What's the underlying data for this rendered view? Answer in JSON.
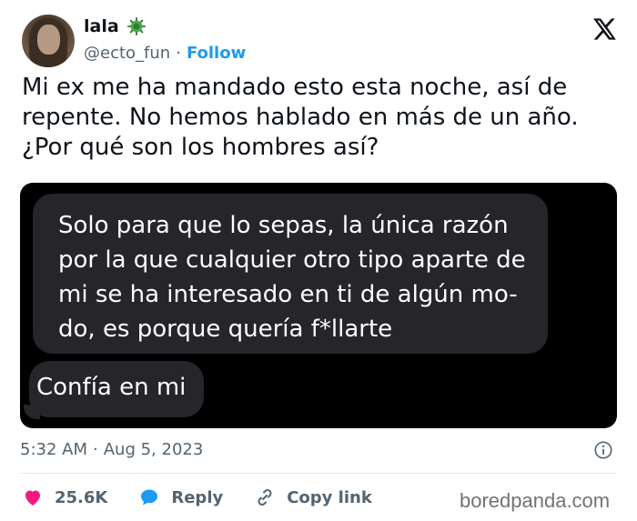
{
  "author": {
    "name": "lala",
    "handle": "@ecto_fun",
    "separator": "·",
    "follow_label": "Follow"
  },
  "tweet": {
    "lines": [
      "Mi ex me ha mandado esto esta noche, así de",
      "repente. No hemos hablado en más de un año.",
      "¿Por qué son los hombres así?"
    ]
  },
  "media": {
    "bubble1_lines": [
      "Solo para que lo sepas, la única razón",
      "por la que cualquier otro tipo aparte de",
      "mi se ha interesado en ti de algún mo-",
      "do, es porque quería f*llarte"
    ],
    "bubble2": "Confía en mi"
  },
  "meta": {
    "time": "5:32 AM",
    "separator": "·",
    "date": "Aug 5, 2023"
  },
  "actions": {
    "likes": "25.6K",
    "reply_label": "Reply",
    "copy_link_label": "Copy link"
  },
  "watermark": "boredpanda.com",
  "colors": {
    "like": "#f91880",
    "reply": "#1d9bf0",
    "follow": "#1d9bf0",
    "muted": "#536471",
    "bubble": "#26252a"
  },
  "icons": [
    "x-logo-icon",
    "virus-badge-icon",
    "info-icon",
    "heart-icon",
    "reply-bubble-icon",
    "link-icon"
  ]
}
